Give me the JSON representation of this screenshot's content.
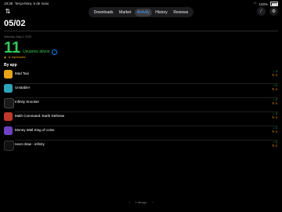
{
  "status_bar": {
    "time": "19:38",
    "date": "Terça-feira, 6 de maio",
    "battery": "100%"
  },
  "tabs": [
    {
      "label": "Downloads",
      "active": false
    },
    {
      "label": "Market",
      "active": false
    },
    {
      "label": "Activity",
      "active": true
    },
    {
      "label": "History",
      "active": false
    },
    {
      "label": "Reviews",
      "active": false
    }
  ],
  "page_title": "05/02",
  "date_line": "Saturday, May 2, 2026",
  "active_users": {
    "count": "11",
    "label": "Usuários ativos"
  },
  "impressions": "11 Impressões",
  "section_title": "By app",
  "apps": [
    {
      "name": "Mad Taxi",
      "up": "4",
      "down": "0",
      "color": "#e8a317"
    },
    {
      "name": "Unstable!",
      "up": "1",
      "down": "0",
      "color": "#2aa6b8"
    },
    {
      "name": "Infinity Snooker",
      "up": "2",
      "down": "0",
      "color": "#1a1a1a"
    },
    {
      "name": "Math Command: Earth Defense",
      "up": "2",
      "down": "0",
      "color": "#c0392b"
    },
    {
      "name": "Money Wall King of coins",
      "up": "1",
      "down": "0",
      "color": "#6f42c1"
    },
    {
      "name": "neon draw - infinity",
      "up": "1",
      "down": "0",
      "color": "#111111"
    }
  ],
  "pager": {
    "prev": "‹",
    "label": "1 dia ago",
    "next": "›"
  }
}
